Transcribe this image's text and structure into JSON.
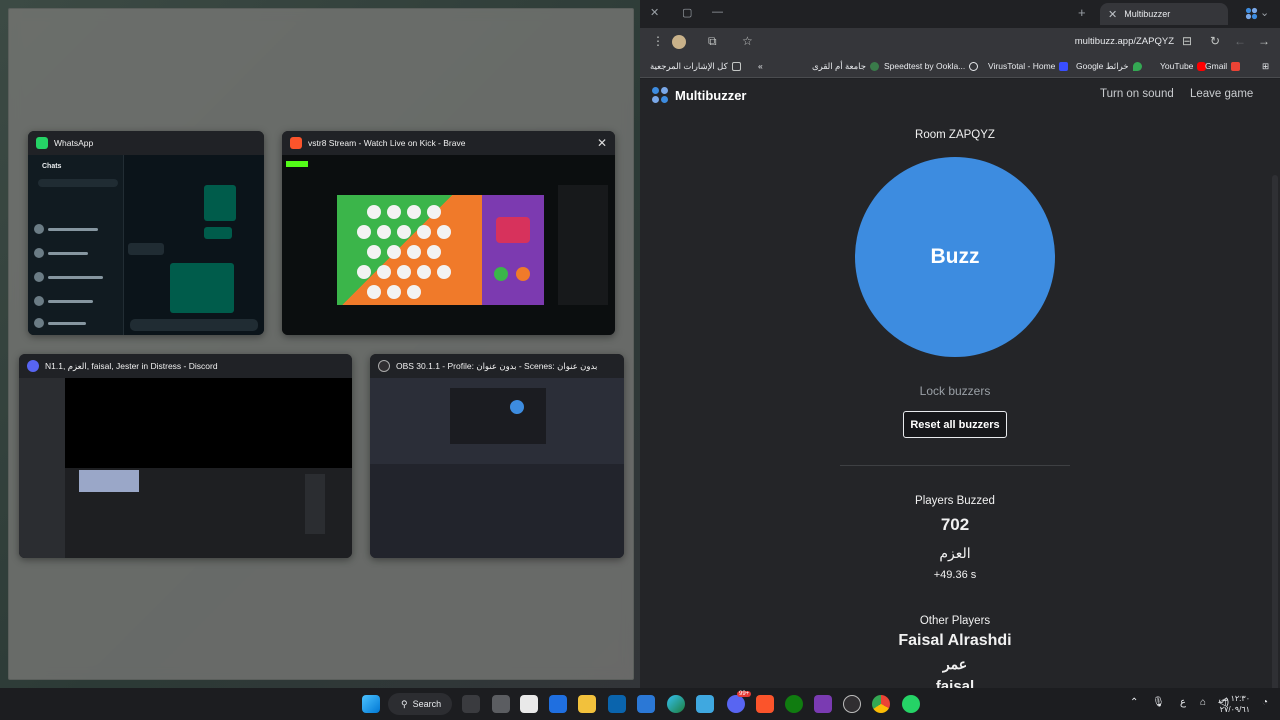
{
  "task_view": {
    "windows": [
      {
        "title": "WhatsApp",
        "icon": "whatsapp-icon"
      },
      {
        "title": "vstr8 Stream - Watch Live on Kick - Brave",
        "icon": "brave-icon"
      },
      {
        "title": "N1.1, العزم, faisal, Jester in Distress - Discord",
        "icon": "discord-icon"
      },
      {
        "title": "OBS 30.1.1 - Profile: بدون عنوان - Scenes: بدون عنوان",
        "icon": "obs-icon"
      }
    ],
    "whatsapp": {
      "chats_label": "Chats"
    }
  },
  "browser": {
    "tab_title": "Multibuzzer",
    "url": "multibuzz.app/ZAPQYZ",
    "bookmarks": [
      {
        "label": "Gmail",
        "icon": "gmail-icon"
      },
      {
        "label": "YouTube",
        "icon": "youtube-icon"
      },
      {
        "label": "Google خرائط",
        "icon": "maps-icon"
      },
      {
        "label": "VirusTotal - Home",
        "icon": "virustotal-icon"
      },
      {
        "label": "Speedtest by Ookla...",
        "icon": "speedtest-icon"
      },
      {
        "label": "جامعة أم القرى",
        "icon": "university-icon"
      },
      {
        "label": "كل الإشارات المرجعية",
        "icon": "folder-icon"
      }
    ]
  },
  "app": {
    "brand": "Multibuzzer",
    "turn_on_sound": "Turn on sound",
    "leave_game": "Leave game",
    "room": "Room ZAPQYZ",
    "buzz": "Buzz",
    "lock_buzzers": "Lock buzzers",
    "reset_all": "Reset all buzzers",
    "players_buzzed_label": "Players Buzzed",
    "buzz_rank": "702",
    "buzz_player": "العزم",
    "buzz_time": "+49.36 s",
    "other_players_label": "Other Players",
    "other_players": [
      "Faisal Alrashdi",
      "عمر",
      "faisal"
    ],
    "accent": "#3d8ce0"
  },
  "taskbar": {
    "search": "Search",
    "time": "١٢:٣٠ ص",
    "date": "٢٧/٠٩/٦١",
    "lang": "ع",
    "discord_badge": "99+"
  }
}
